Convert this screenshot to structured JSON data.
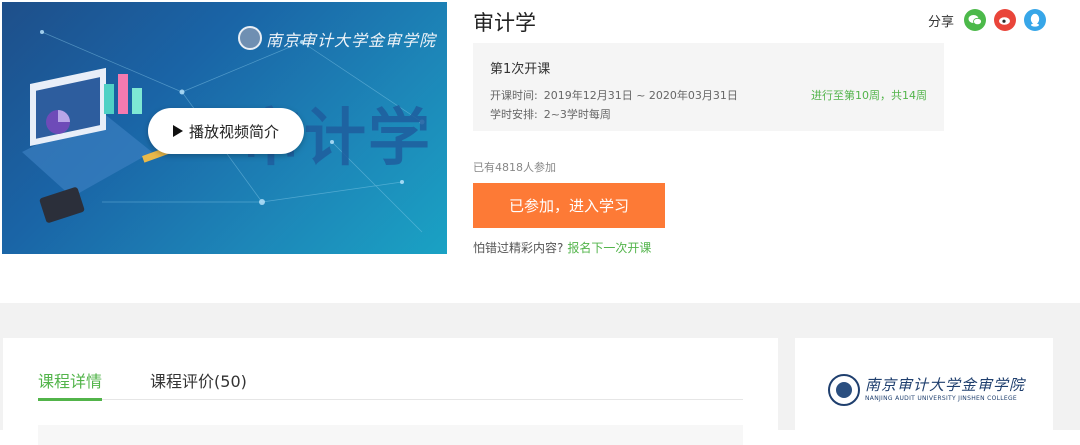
{
  "cover": {
    "school_logo_text": "南京审计大学金审学院",
    "title_art": "审计学",
    "play_label": "播放视频简介"
  },
  "course": {
    "title": "审计学"
  },
  "share": {
    "label": "分享",
    "icons": [
      "wechat-icon",
      "weibo-icon",
      "qq-icon"
    ],
    "colors": {
      "wechat": "#4cb94a",
      "weibo": "#e9453a",
      "qq": "#37a6e8"
    }
  },
  "session": {
    "name": "第1次开课",
    "time_label": "开课时间:",
    "time_value": "2019年12月31日 ~ 2020年03月31日",
    "progress": "进行至第10周，共14周",
    "schedule_label": "学时安排:",
    "schedule_value": "2~3学时每周"
  },
  "enroll": {
    "joined_text": "已有4818人参加",
    "button_label": "已参加，进入学习",
    "miss_text": "怕错过精彩内容?",
    "miss_link": "报名下一次开课"
  },
  "tabs": [
    {
      "label": "课程详情",
      "active": true
    },
    {
      "label": "课程评价(50)",
      "active": false
    }
  ],
  "sidebar": {
    "school_name": "南京审计大学金审学院",
    "school_name_en": "NANJING AUDIT UNIVERSITY JINSHEN COLLEGE"
  },
  "theme": {
    "accent_green": "#52b44a",
    "button_orange": "#fd7a36"
  }
}
